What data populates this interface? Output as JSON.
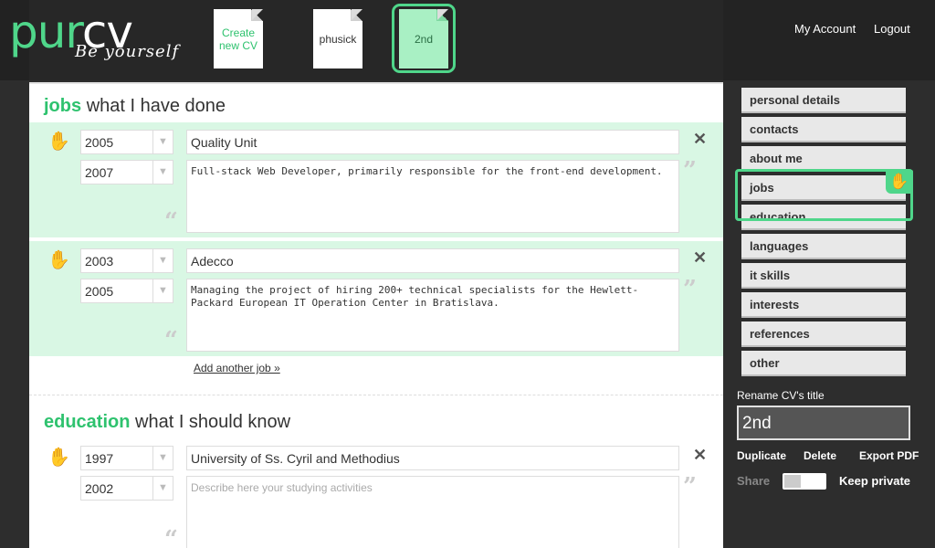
{
  "app": {
    "logo_pur": "pur",
    "logo_cv": "cv",
    "tagline": "Be yourself"
  },
  "cv_tabs": [
    {
      "label": "Create new CV"
    },
    {
      "label": "phusick"
    },
    {
      "label": "2nd",
      "selected": true
    }
  ],
  "header": {
    "my_account": "My Account",
    "logout": "Logout"
  },
  "jobs": {
    "title_kw": "jobs",
    "title_rest": "what I have done",
    "entries": [
      {
        "from": "2005",
        "to": "2007",
        "company": "Quality Unit",
        "description": "Full-stack Web Developer, primarily responsible for the front-end development."
      },
      {
        "from": "2003",
        "to": "2005",
        "company": "Adecco",
        "description": "Managing the project of hiring 200+ technical specialists for the Hewlett-Packard European IT Operation Center in Bratislava."
      }
    ],
    "add_link": "Add another job »"
  },
  "education": {
    "title_kw": "education",
    "title_rest": "what I should know",
    "entries": [
      {
        "from": "1997",
        "to": "2002",
        "school": "University of Ss. Cyril and Methodius",
        "description_placeholder": "Describe here your studying activities"
      }
    ]
  },
  "sidebar": {
    "items": [
      {
        "label": "personal details"
      },
      {
        "label": "contacts"
      },
      {
        "label": "about me"
      },
      {
        "label": "jobs",
        "active": true
      },
      {
        "label": "education"
      },
      {
        "label": "languages"
      },
      {
        "label": "it skills"
      },
      {
        "label": "interests"
      },
      {
        "label": "references"
      },
      {
        "label": "other"
      }
    ],
    "rename_label": "Rename CV's title",
    "rename_value": "2nd",
    "duplicate": "Duplicate",
    "delete": "Delete",
    "export_pdf": "Export PDF",
    "share": "Share",
    "keep_private": "Keep private"
  },
  "colors": {
    "accent": "#4fd68a",
    "accent_text": "#2ec26e",
    "entry_bg": "#d9f7e4",
    "dark_bg": "#2d2d2d"
  },
  "icons": {
    "hand": "grab-hand-icon",
    "remove": "close-icon",
    "dropdown": "chevron-down-icon",
    "quote_open": "quote-open-icon",
    "quote_close": "quote-close-icon"
  }
}
